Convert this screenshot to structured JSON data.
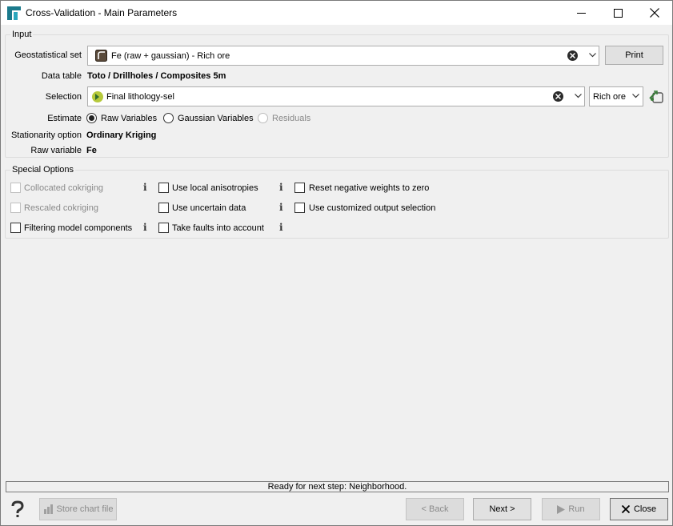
{
  "window": {
    "title": "Cross-Validation - Main Parameters"
  },
  "input_group": {
    "title": "Input",
    "geostat_label": "Geostatistical set",
    "geostat_value": "Fe (raw + gaussian) - Rich ore",
    "print_label": "Print",
    "data_table_label": "Data table",
    "data_table_value": "Toto / Drillholes / Composites 5m",
    "selection_label": "Selection",
    "selection_value": "Final lithology-sel",
    "selection_category": "Rich ore",
    "estimate_label": "Estimate",
    "estimate_options": [
      "Raw Variables",
      "Gaussian Variables",
      "Residuals"
    ],
    "estimate_selected": "Raw Variables",
    "stationarity_label": "Stationarity option",
    "stationarity_value": "Ordinary Kriging",
    "raw_variable_label": "Raw variable",
    "raw_variable_value": "Fe"
  },
  "special_group": {
    "title": "Special Options",
    "options": [
      {
        "label": "Collocated cokriging",
        "enabled": false,
        "checked": false
      },
      {
        "label": "Use local anisotropies",
        "enabled": true,
        "checked": false
      },
      {
        "label": "Reset negative weights to zero",
        "enabled": true,
        "checked": false
      },
      {
        "label": "Rescaled cokriging",
        "enabled": false,
        "checked": false
      },
      {
        "label": "Use uncertain data",
        "enabled": true,
        "checked": false
      },
      {
        "label": "Use customized output selection",
        "enabled": true,
        "checked": false
      },
      {
        "label": "Filtering model components",
        "enabled": true,
        "checked": false
      },
      {
        "label": "Take faults into account",
        "enabled": true,
        "checked": false
      }
    ],
    "info_glyph": "i"
  },
  "status_text": "Ready for next step: Neighborhood.",
  "footer": {
    "store_chart": "Store chart file",
    "back": "< Back",
    "next": "Next >",
    "run": "Run",
    "close": "Close"
  },
  "icons": {
    "help": "question-mark-icon",
    "close_x": "close-icon",
    "link": "link-icon"
  }
}
